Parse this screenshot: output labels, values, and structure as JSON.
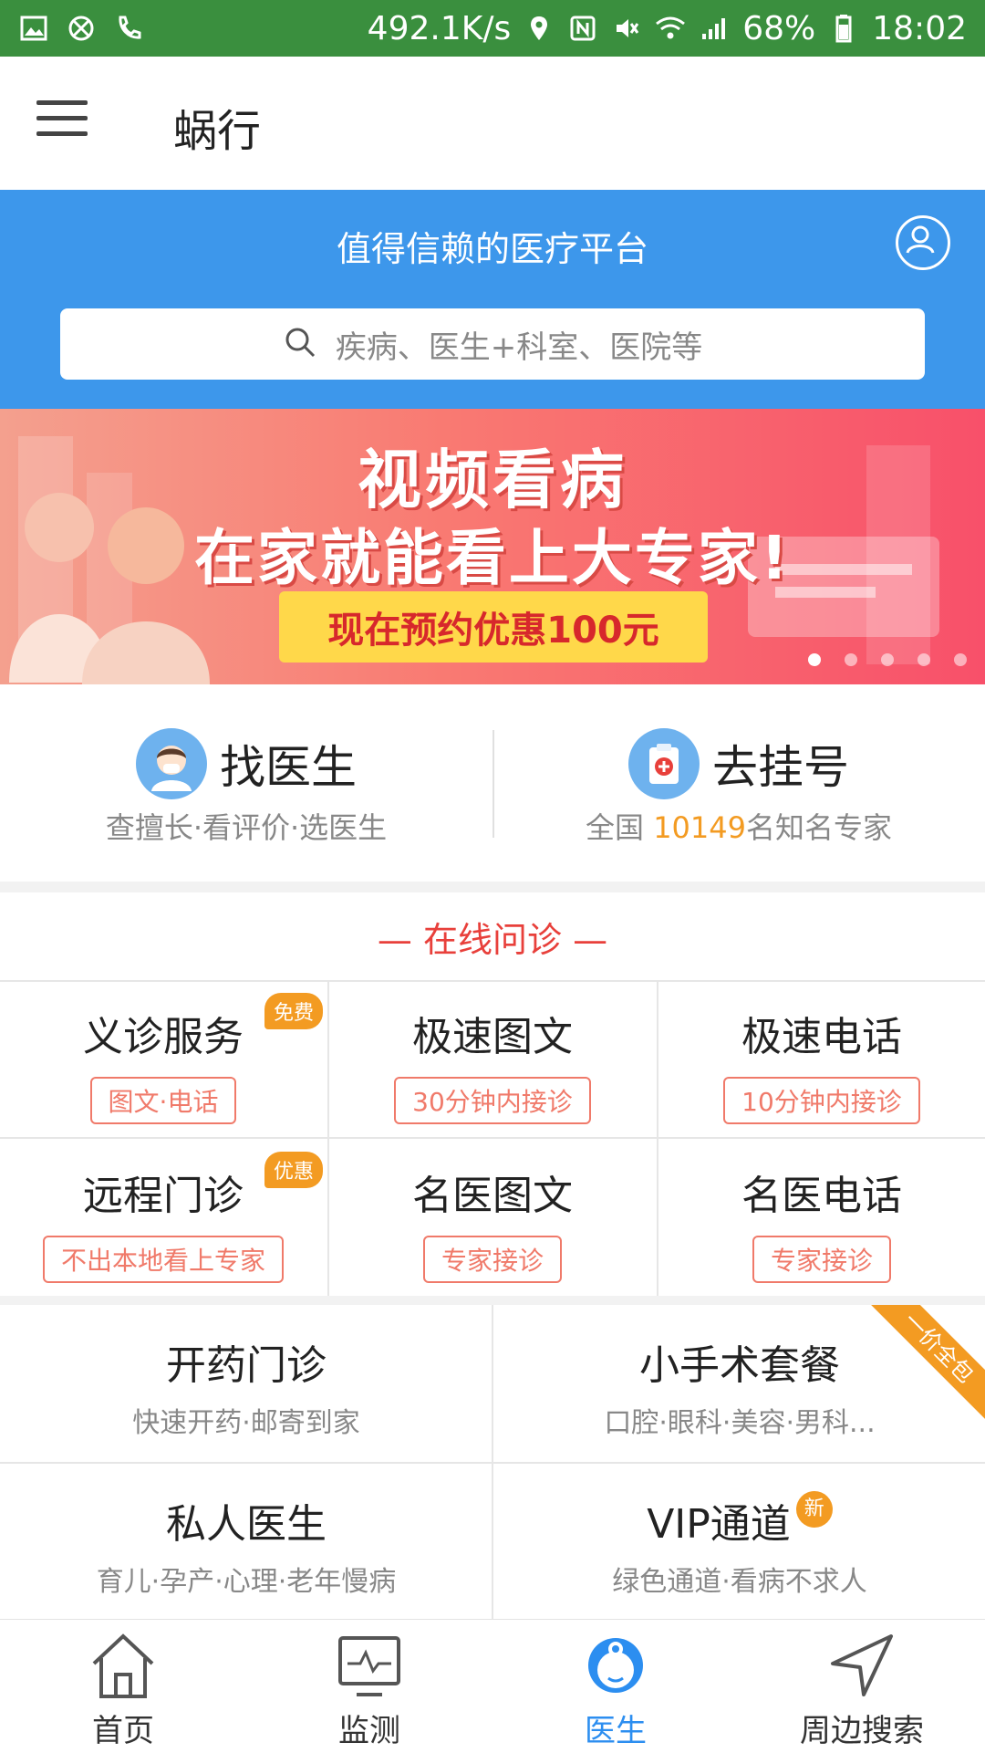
{
  "status_bar": {
    "speed": "492.1K/s",
    "battery": "68%",
    "time": "18:02"
  },
  "app": {
    "title": "蜗行"
  },
  "hero": {
    "slogan": "值得信赖的医疗平台",
    "search_placeholder": "疾病、医生+科室、医院等"
  },
  "banner": {
    "line1": "视频看病",
    "line2": "在家就能看上大专家!",
    "promo": "现在预约优惠100元",
    "slides": 5,
    "active_slide": 1
  },
  "quick": {
    "find_doctor": {
      "title": "找医生",
      "subtitle": "查擅长·看评价·选医生"
    },
    "register": {
      "title": "去挂号",
      "subtitle_pre": "全国 ",
      "count": "10149",
      "subtitle_post": "名知名专家"
    }
  },
  "online": {
    "heading": "—  在线问诊  —",
    "items": [
      {
        "title": "义诊服务",
        "tag": "图文·电话",
        "badge": "免费"
      },
      {
        "title": "极速图文",
        "tag": "30分钟内接诊"
      },
      {
        "title": "极速电话",
        "tag": "10分钟内接诊"
      },
      {
        "title": "远程门诊",
        "tag": "不出本地看上专家",
        "badge": "优惠"
      },
      {
        "title": "名医图文",
        "tag": "专家接诊"
      },
      {
        "title": "名医电话",
        "tag": "专家接诊"
      }
    ]
  },
  "services": [
    {
      "title": "开药门诊",
      "subtitle": "快速开药·邮寄到家"
    },
    {
      "title": "小手术套餐",
      "subtitle": "口腔·眼科·美容·男科...",
      "ribbon": "一价全包"
    },
    {
      "title": "私人医生",
      "subtitle": "育儿·孕产·心理·老年慢病"
    },
    {
      "title": "VIP通道",
      "subtitle": "绿色通道·看病不求人",
      "badge": "新"
    }
  ],
  "nav": [
    {
      "label": "首页",
      "icon": "home-icon"
    },
    {
      "label": "监测",
      "icon": "monitor-icon"
    },
    {
      "label": "医生",
      "icon": "doctor-icon",
      "active": true
    },
    {
      "label": "周边搜索",
      "icon": "location-arrow-icon"
    }
  ],
  "colors": {
    "status_bar": "#3a8f3e",
    "hero": "#3d97eb",
    "accent_red": "#e8403b",
    "accent_orange": "#f39b22",
    "nav_active": "#2c8ef0"
  }
}
